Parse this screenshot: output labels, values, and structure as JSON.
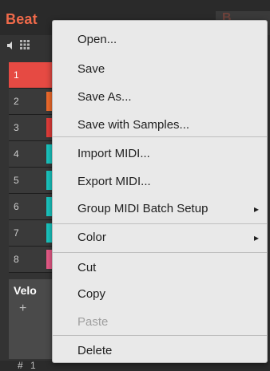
{
  "group": {
    "name": "Beat"
  },
  "tracks": [
    {
      "num": "1",
      "selected": true,
      "color": ""
    },
    {
      "num": "2",
      "color": "#f06b2b"
    },
    {
      "num": "3",
      "color": "#e23c39"
    },
    {
      "num": "4",
      "color": "#19c6c0"
    },
    {
      "num": "5",
      "color": "#19c6c0"
    },
    {
      "num": "6",
      "color": "#19c6c0"
    },
    {
      "num": "7",
      "color": "#19c6c0"
    },
    {
      "num": "8",
      "color": "#e85a88"
    }
  ],
  "panel": {
    "velocity_label": "Velo",
    "plus": "+"
  },
  "bottom": {
    "hash": "#",
    "first": "1"
  },
  "menu": {
    "items": [
      {
        "label": "Open..."
      },
      {
        "label": "Save"
      },
      {
        "label": "Save As..."
      },
      {
        "label": "Save with Samples..."
      },
      {
        "label": "Import MIDI..."
      },
      {
        "label": "Export MIDI..."
      },
      {
        "label": "Group MIDI Batch Setup",
        "submenu": true
      },
      {
        "label": "Color",
        "submenu": true
      },
      {
        "label": "Cut"
      },
      {
        "label": "Copy"
      },
      {
        "label": "Paste",
        "disabled": true
      },
      {
        "label": "Delete"
      }
    ],
    "submenu_arrow": "▸"
  }
}
